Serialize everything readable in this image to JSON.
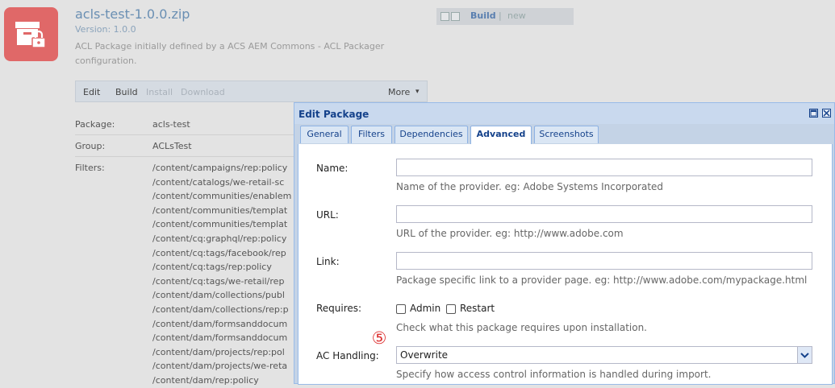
{
  "package": {
    "title": "acls-test-1.0.0.zip",
    "version": "Version: 1.0.0",
    "description": "ACL Package initially defined by a ACS AEM Commons - ACL Packager configuration.",
    "icon": "package-lock-icon",
    "icon_color": "#e06868"
  },
  "build_status": {
    "build": "Build",
    "separator": "|",
    "status": "new"
  },
  "toolbar": {
    "edit": "Edit",
    "build": "Build",
    "install": "Install",
    "download": "Download",
    "more": "More",
    "more_arrow": "▾"
  },
  "info": {
    "package_label": "Package:",
    "package_value": "acls-test",
    "group_label": "Group:",
    "group_value": "ACLsTest",
    "filters_label": "Filters:",
    "filters": [
      "/content/campaigns/rep:policy",
      "/content/catalogs/we-retail-sc",
      "/content/communities/enablem",
      "/content/communities/templat",
      "/content/communities/templat",
      "/content/cq:graphql/rep:policy",
      "/content/cq:tags/facebook/rep",
      "/content/cq:tags/rep:policy",
      "/content/cq:tags/we-retail/rep",
      "/content/dam/collections/publ",
      "/content/dam/collections/rep:p",
      "/content/dam/formsanddocum",
      "/content/dam/formsanddocum",
      "/content/dam/projects/rep:pol",
      "/content/dam/projects/we-reta",
      "/content/dam/rep:policy"
    ]
  },
  "dialog": {
    "title": "Edit Package",
    "tabs": [
      "General",
      "Filters",
      "Dependencies",
      "Advanced",
      "Screenshots"
    ],
    "active_tab": "Advanced",
    "fields": {
      "name_label": "Name:",
      "name_value": "",
      "name_hint": "Name of the provider. eg: Adobe Systems Incorporated",
      "url_label": "URL:",
      "url_value": "",
      "url_hint": "URL of the provider. eg: http://www.adobe.com",
      "link_label": "Link:",
      "link_value": "",
      "link_hint": "Package specific link to a provider page. eg: http://www.adobe.com/mypackage.html",
      "requires_label": "Requires:",
      "admin_label": "Admin",
      "restart_label": "Restart",
      "requires_hint": "Check what this package requires upon installation.",
      "ac_label": "AC Handling:",
      "ac_value": "Overwrite",
      "ac_hint": "Specify how access control information is handled during import."
    }
  },
  "annotation": {
    "marker": "⑤",
    "color": "#dd3333"
  }
}
